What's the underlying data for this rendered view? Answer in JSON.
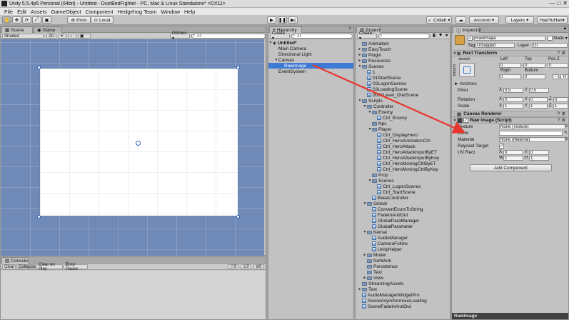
{
  "window": {
    "title": "Unity 5.5.4p5 Personal (64bit) - Untitled - DustBedFighter - PC, Mac & Linux Standalone* <DX11>",
    "controls": [
      "—",
      "□",
      "✕"
    ]
  },
  "menu": [
    "File",
    "Edit",
    "Assets",
    "GameObject",
    "Component",
    "Hedgehog Team",
    "Window",
    "Help"
  ],
  "toolbar": {
    "pivot": "Pivot",
    "local": "Local",
    "collab": "Collab ▾",
    "account": "Account ▾",
    "layers": "Layers",
    "layout": "HaoYuHan▾"
  },
  "scene": {
    "tab_scene": "Scene",
    "tab_game": "Game",
    "shading": "Shaded",
    "mode_2d": "2D",
    "gizmos": "Gizmos ▾",
    "search_all": "All"
  },
  "console": {
    "tab": "Console",
    "buttons": [
      "Clear",
      "Collapse",
      "Clear on Play",
      "Error Pause"
    ],
    "counts": [
      "0",
      "0",
      "0"
    ]
  },
  "hierarchy": {
    "tab": "Hierarchy",
    "create": "Create ▾",
    "search": "All",
    "scene_name": "Untitled*",
    "items": [
      {
        "label": "Main Camera",
        "depth": 1
      },
      {
        "label": "Directional Light",
        "depth": 1
      },
      {
        "label": "Canvas",
        "depth": 1,
        "expanded": true
      },
      {
        "label": "RawImage",
        "depth": 2,
        "selected": true
      },
      {
        "label": "EventSystem",
        "depth": 1
      }
    ]
  },
  "project": {
    "tab": "Project",
    "create": "Create ▾",
    "items": [
      {
        "label": "Animation",
        "depth": 0,
        "type": "folder",
        "arrow": ""
      },
      {
        "label": "EasyTouch",
        "depth": 0,
        "type": "folder",
        "arrow": "►"
      },
      {
        "label": "Plugin",
        "depth": 0,
        "type": "folder",
        "arrow": "►"
      },
      {
        "label": "Resources",
        "depth": 0,
        "type": "folder",
        "arrow": "►"
      },
      {
        "label": "Scenes",
        "depth": 0,
        "type": "folder",
        "arrow": "▼"
      },
      {
        "label": "1",
        "depth": 1,
        "type": "scene",
        "arrow": ""
      },
      {
        "label": "01StartScene",
        "depth": 1,
        "type": "scene",
        "arrow": ""
      },
      {
        "label": "02LogonScenes",
        "depth": 1,
        "type": "scene",
        "arrow": ""
      },
      {
        "label": "03LoadingScene",
        "depth": 1,
        "type": "scene",
        "arrow": ""
      },
      {
        "label": "0001Level_OneScene",
        "depth": 1,
        "type": "scene",
        "arrow": ""
      },
      {
        "label": "Scripts",
        "depth": 0,
        "type": "folder",
        "arrow": "▼"
      },
      {
        "label": "Controller",
        "depth": 1,
        "type": "folder",
        "arrow": "▼"
      },
      {
        "label": "Enemy",
        "depth": 2,
        "type": "folder",
        "arrow": "▼"
      },
      {
        "label": "Ctrl_Enemy",
        "depth": 3,
        "type": "script",
        "arrow": ""
      },
      {
        "label": "Npc",
        "depth": 2,
        "type": "folder",
        "arrow": ""
      },
      {
        "label": "Player",
        "depth": 2,
        "type": "folder",
        "arrow": "▼"
      },
      {
        "label": "Ctrl_DisplayHero",
        "depth": 3,
        "type": "script",
        "arrow": ""
      },
      {
        "label": "Ctrl_HeroAnimationCtrl",
        "depth": 3,
        "type": "script",
        "arrow": ""
      },
      {
        "label": "Ctrl_HeroAttack",
        "depth": 3,
        "type": "script",
        "arrow": ""
      },
      {
        "label": "Ctrl_HeroAttackInputByET",
        "depth": 3,
        "type": "script",
        "arrow": ""
      },
      {
        "label": "Ctrl_HeroAttackInputByKey",
        "depth": 3,
        "type": "script",
        "arrow": ""
      },
      {
        "label": "Ctrl_HeroMovingCtrlByET",
        "depth": 3,
        "type": "script",
        "arrow": ""
      },
      {
        "label": "Ctrl_HeroMovingCtrlByKey",
        "depth": 3,
        "type": "script",
        "arrow": ""
      },
      {
        "label": "Prop",
        "depth": 2,
        "type": "folder",
        "arrow": ""
      },
      {
        "label": "Scenes",
        "depth": 2,
        "type": "folder",
        "arrow": "▼"
      },
      {
        "label": "Ctrl_LogonScenes",
        "depth": 3,
        "type": "script",
        "arrow": ""
      },
      {
        "label": "Ctrl_StartScene",
        "depth": 3,
        "type": "script",
        "arrow": ""
      },
      {
        "label": "BaseController",
        "depth": 2,
        "type": "script",
        "arrow": ""
      },
      {
        "label": "Global",
        "depth": 1,
        "type": "folder",
        "arrow": "▼"
      },
      {
        "label": "ConvertEnumToString",
        "depth": 2,
        "type": "script",
        "arrow": ""
      },
      {
        "label": "FadeInAndOut",
        "depth": 2,
        "type": "script",
        "arrow": ""
      },
      {
        "label": "GlobalParaManager",
        "depth": 2,
        "type": "script",
        "arrow": ""
      },
      {
        "label": "GlobalParameter",
        "depth": 2,
        "type": "script",
        "arrow": ""
      },
      {
        "label": "Kernal",
        "depth": 1,
        "type": "folder",
        "arrow": "▼"
      },
      {
        "label": "AudioManager",
        "depth": 2,
        "type": "script",
        "arrow": ""
      },
      {
        "label": "CameraFollow",
        "depth": 2,
        "type": "script",
        "arrow": ""
      },
      {
        "label": "UnityHelper",
        "depth": 2,
        "type": "script",
        "arrow": ""
      },
      {
        "label": "Model",
        "depth": 1,
        "type": "folder",
        "arrow": "►"
      },
      {
        "label": "NetWork",
        "depth": 1,
        "type": "folder",
        "arrow": ""
      },
      {
        "label": "Persistence",
        "depth": 1,
        "type": "folder",
        "arrow": ""
      },
      {
        "label": "Text",
        "depth": 1,
        "type": "folder",
        "arrow": ""
      },
      {
        "label": "View",
        "depth": 1,
        "type": "folder",
        "arrow": "►"
      },
      {
        "label": "StreamingAssets",
        "depth": 0,
        "type": "folder",
        "arrow": ""
      },
      {
        "label": "Text",
        "depth": 0,
        "type": "folder",
        "arrow": "►"
      },
      {
        "label": "AudioManagerWidgetPro",
        "depth": 0,
        "type": "script",
        "arrow": ""
      },
      {
        "label": "SceneAsynchronousLoading",
        "depth": 0,
        "type": "script",
        "arrow": ""
      },
      {
        "label": "SceneFadeInAndOut",
        "depth": 0,
        "type": "script",
        "arrow": ""
      }
    ]
  },
  "inspector": {
    "tab": "Inspector",
    "object_name": "RawImage",
    "static": "Static ▾",
    "tag_label": "Tag",
    "tag_value": "Untagged",
    "layer_label": "Layer",
    "layer_value": "UI",
    "rect_transform": {
      "title": "Rect Transform",
      "stretch_label": "stretch",
      "stretch_side": "stretch",
      "left": "Left",
      "top": "Top",
      "posz": "Pos Z",
      "left_val": "0",
      "top_val": "0",
      "posz_val": "0",
      "right": "Right",
      "bottom": "Bottom",
      "right_val": "0",
      "bottom_val": "0",
      "anchors": "Anchors",
      "pivot": "Pivot",
      "pivot_x": "0.5",
      "pivot_y": "0.5",
      "rotation": "Rotation",
      "rot_x": "0",
      "rot_y": "0",
      "rot_z": "0",
      "scale": "Scale",
      "scale_x": "1",
      "scale_y": "1",
      "scale_z": "1",
      "btn_r": "R"
    },
    "canvas_renderer": "Canvas Renderer",
    "raw_image": {
      "title": "Raw Image (Script)",
      "texture": "Texture",
      "texture_val": "None (Texture)",
      "color": "Color",
      "material": "Material",
      "material_val": "None (Material)",
      "raycast": "Raycast Target",
      "uvrect": "UV Rect",
      "uv_x": "0",
      "uv_y": "0",
      "uv_w": "1",
      "uv_h": "1"
    },
    "add_component": "Add Component",
    "preview_label": "RawImage"
  },
  "colors": {
    "selection": "#3d7ad6",
    "scene_bg": "#6f8ab7",
    "annotation_arrow": "#e8362e"
  }
}
